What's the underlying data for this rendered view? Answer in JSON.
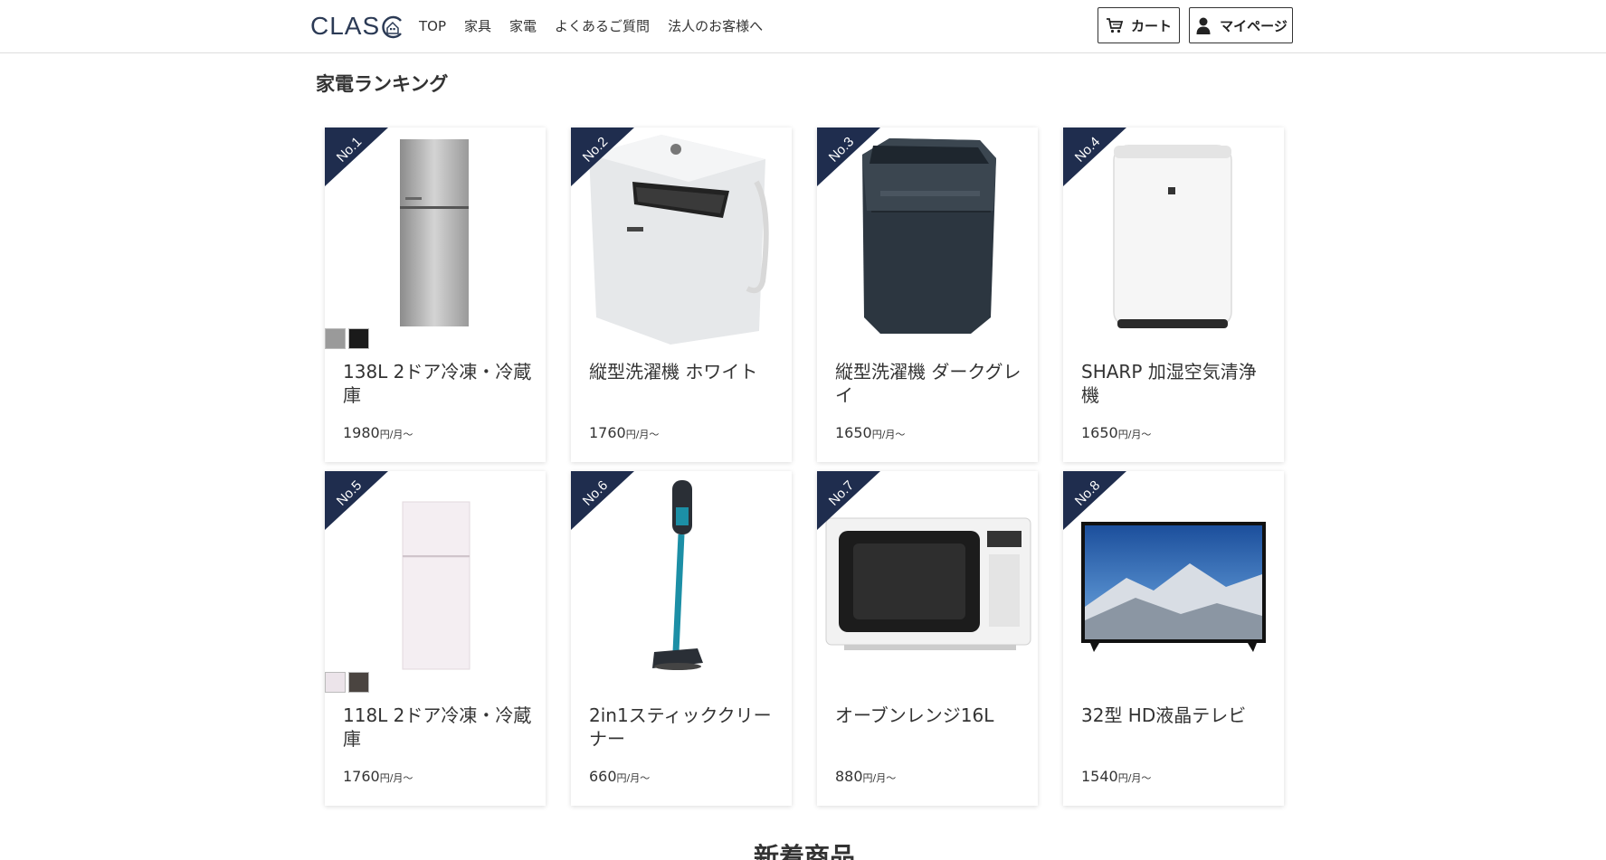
{
  "header": {
    "logo_text": "CLAS",
    "nav": [
      "TOP",
      "家具",
      "家電",
      "よくあるご質問",
      "法人のお客様へ"
    ],
    "cart_label": "カート",
    "mypage_label": "マイページ",
    "cart_icon": "cart-icon",
    "mypage_icon": "user-icon"
  },
  "section_title": "家電ランキング",
  "rank_color": "#1f2d4e",
  "products": [
    {
      "rank": "No.1",
      "name": "138L 2ドア冷凍・冷蔵庫",
      "price": "1980",
      "unit": "円/月〜",
      "swatches": [
        "#9a9a9a",
        "#1a1a1a"
      ]
    },
    {
      "rank": "No.2",
      "name": "縦型洗濯機 ホワイト",
      "price": "1760",
      "unit": "円/月〜",
      "swatches": []
    },
    {
      "rank": "No.3",
      "name": "縦型洗濯機 ダークグレイ",
      "price": "1650",
      "unit": "円/月〜",
      "swatches": []
    },
    {
      "rank": "No.4",
      "name": "SHARP 加湿空気清浄機",
      "price": "1650",
      "unit": "円/月〜",
      "swatches": []
    },
    {
      "rank": "No.5",
      "name": "118L 2ドア冷凍・冷蔵庫",
      "price": "1760",
      "unit": "円/月〜",
      "swatches": [
        "#ece4ea",
        "#4a4440"
      ]
    },
    {
      "rank": "No.6",
      "name": "2in1スティッククリーナー",
      "price": "660",
      "unit": "円/月〜",
      "swatches": []
    },
    {
      "rank": "No.7",
      "name": "オーブンレンジ16L",
      "price": "880",
      "unit": "円/月〜",
      "swatches": []
    },
    {
      "rank": "No.8",
      "name": "32型 HD液晶テレビ",
      "price": "1540",
      "unit": "円/月〜",
      "swatches": []
    }
  ],
  "bottom_section_title": "新着商品"
}
